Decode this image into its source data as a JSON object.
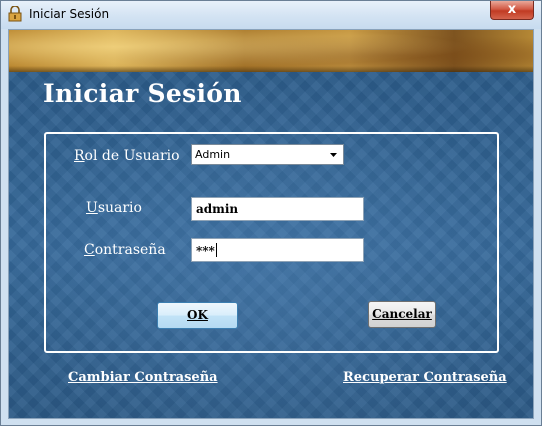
{
  "window": {
    "title": "Iniciar Sesión",
    "close_glyph": "x"
  },
  "form": {
    "heading": "Iniciar Sesión",
    "role": {
      "label_first": "R",
      "label_rest": "ol de Usuario",
      "selected": "Admin"
    },
    "user": {
      "label_first": "U",
      "label_rest": "suario",
      "value": "admin"
    },
    "password": {
      "label_first": "C",
      "label_rest": "ontraseña",
      "value": "***"
    },
    "ok_label": "OK",
    "cancel_label": "Cancelar",
    "change_password": "Cambiar Contraseña",
    "recover_password": "Recuperar Contraseña"
  },
  "colors": {
    "background_blue": "#2f5e8b",
    "banner_gold": "#c89a44",
    "text_white": "#ffffff",
    "close_red": "#c13b23"
  },
  "icons": {
    "app": "key-lock-icon",
    "dropdown": "chevron-down-icon"
  }
}
